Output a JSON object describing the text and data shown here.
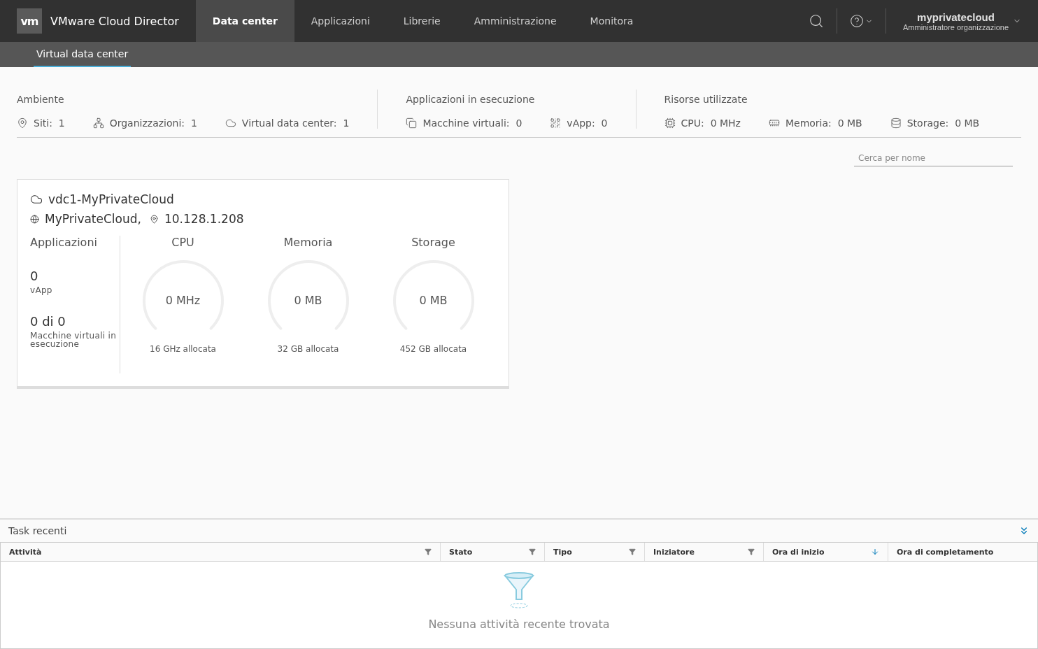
{
  "header": {
    "logo": "vm",
    "app_name": "VMware Cloud Director",
    "nav": [
      {
        "label": "Data center",
        "selected": true
      },
      {
        "label": "Applicazioni",
        "selected": false
      },
      {
        "label": "Librerie",
        "selected": false
      },
      {
        "label": "Amministrazione",
        "selected": false
      },
      {
        "label": "Monitora",
        "selected": false
      }
    ],
    "user": {
      "name": "myprivatecloud",
      "role": "Amministratore organizzazione"
    }
  },
  "subnav": [
    {
      "label": "Virtual data center",
      "selected": true
    }
  ],
  "summary": [
    {
      "title": "Ambiente",
      "items": [
        {
          "kind": "site",
          "label": "Siti:",
          "value": "1"
        },
        {
          "kind": "org",
          "label": "Organizzazioni:",
          "value": "1"
        },
        {
          "kind": "vdc",
          "label": "Virtual data center:",
          "value": "1"
        }
      ]
    },
    {
      "title": "Applicazioni in esecuzione",
      "items": [
        {
          "kind": "vm",
          "label": "Macchine virtuali:",
          "value": "0"
        },
        {
          "kind": "vapp",
          "label": "vApp:",
          "value": "0"
        }
      ]
    },
    {
      "title": "Risorse utilizzate",
      "items": [
        {
          "kind": "cpu",
          "label": "CPU:",
          "value": "0 MHz"
        },
        {
          "kind": "memory",
          "label": "Memoria:",
          "value": "0 MB"
        },
        {
          "kind": "storage",
          "label": "Storage:",
          "value": "0 MB"
        }
      ]
    }
  ],
  "search": {
    "placeholder": "Cerca per nome"
  },
  "vdc_card": {
    "name": "vdc1-MyPrivateCloud",
    "org": "MyPrivateCloud,",
    "ip": "10.128.1.208",
    "apps_title": "Applicazioni",
    "apps": [
      {
        "value": "0",
        "label": "vApp"
      },
      {
        "value": "0 di 0",
        "label": "Macchine virtuali in esecuzione"
      }
    ],
    "gauges": [
      {
        "title": "CPU",
        "value": "0 MHz",
        "caption": "16 GHz allocata"
      },
      {
        "title": "Memoria",
        "value": "0 MB",
        "caption": "32 GB allocata"
      },
      {
        "title": "Storage",
        "value": "0 MB",
        "caption": "452 GB allocata"
      }
    ]
  },
  "tasks": {
    "title": "Task recenti",
    "columns": [
      {
        "label": "Attività",
        "kind": "filter"
      },
      {
        "label": "Stato",
        "kind": "filter"
      },
      {
        "label": "Tipo",
        "kind": "filter"
      },
      {
        "label": "Iniziatore",
        "kind": "filter"
      },
      {
        "label": "Ora di inizio",
        "kind": "sort"
      },
      {
        "label": "Ora di completamento",
        "kind": "none"
      }
    ],
    "empty": "Nessuna attività recente trovata"
  }
}
